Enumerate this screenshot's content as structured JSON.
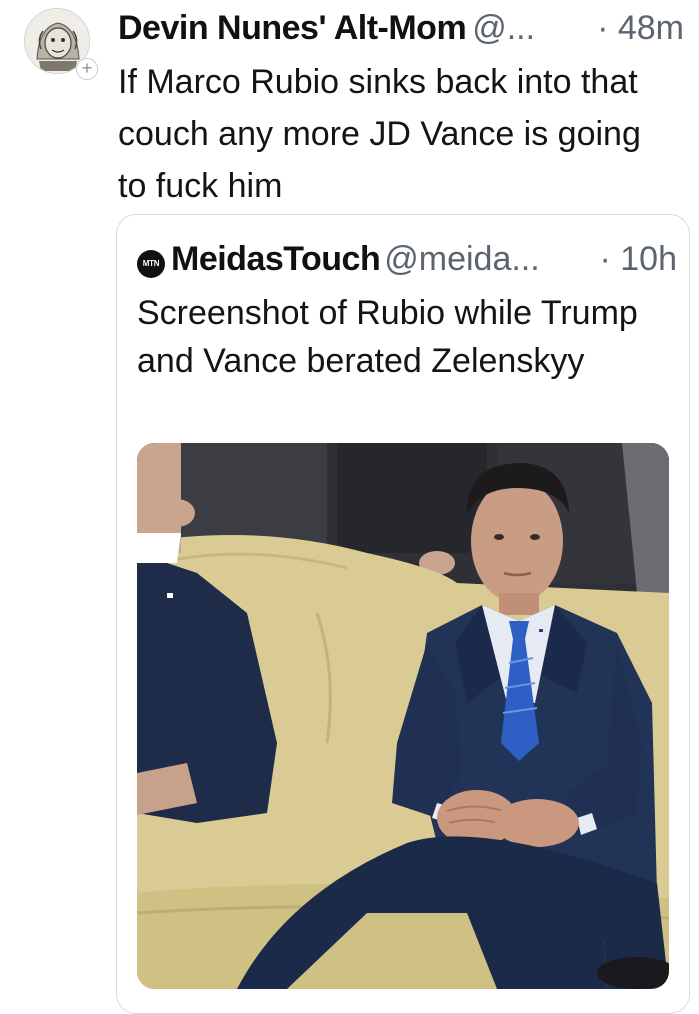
{
  "tweet": {
    "avatar_icon": "cartoon-portrait-avatar",
    "follow_badge": "+",
    "display_name": "Devin Nunes' Alt-Mom",
    "handle": "@...",
    "timestamp": "· 48m",
    "text": "If Marco Rubio sinks back into that couch any more JD Vance is going to fuck him"
  },
  "quoted_tweet": {
    "logo_text": "MTN",
    "display_name": "MeidasTouch",
    "handle": "@meida...",
    "timestamp": "· 10h",
    "text": "Screenshot of Rubio while Trump and Vance berated Zelenskyy",
    "media": {
      "kind": "photo",
      "subject": "man-in-navy-suit-seated-on-yellow-couch"
    }
  },
  "colors": {
    "text_primary": "#111111",
    "text_secondary": "#5b6570",
    "card_border": "#d7dbe0",
    "suit_navy": "#223358",
    "tie_blue": "#2d5fc4",
    "couch_yellow": "#d8c98f"
  }
}
